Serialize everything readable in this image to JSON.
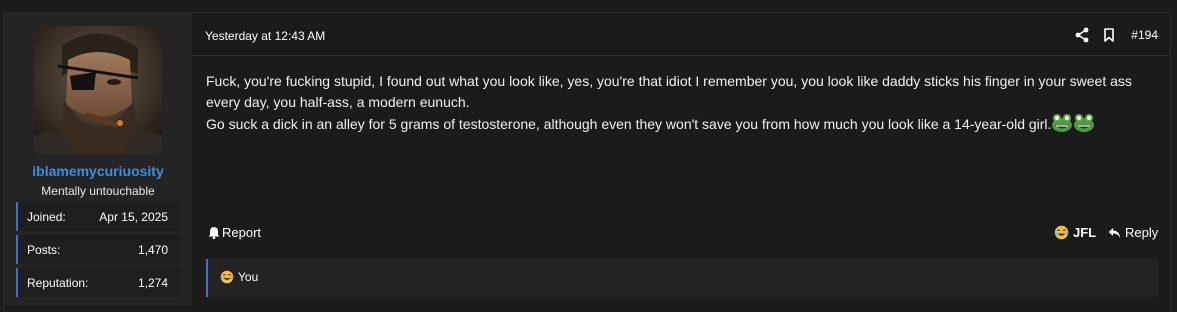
{
  "user": {
    "username": "iblamemycuriuosity",
    "title": "Mentally untouchable",
    "avatar_icon": "bearded-eyepatch-man-avatar",
    "stats": [
      {
        "label": "Joined:",
        "value": "Apr 15, 2025"
      },
      {
        "label": "Posts:",
        "value": "1,470"
      },
      {
        "label": "Reputation:",
        "value": "1,274"
      }
    ]
  },
  "post": {
    "timestamp": "Yesterday at 12:43 AM",
    "post_number": "#194",
    "message_lines": [
      "Fuck, you're fucking stupid, I found out what you look like, yes, you're that idiot I remember you, you look like daddy sticks his finger in your sweet ass every day, you half-ass, a modern eunuch.",
      "Go suck a dick in an alley for 5 grams of testosterone, although even they won't save you from how much you look like a 14-year-old girl."
    ],
    "inline_emojis": [
      "frog-laugh-emoji",
      "frog-laugh-emoji"
    ]
  },
  "actions": {
    "report_label": "Report",
    "report_icon": "bell-icon",
    "reaction_label": "JFL",
    "reaction_icon": "laughing-tears-emoji",
    "reply_label": "Reply",
    "reply_icon": "reply-arrow-icon",
    "share_icon": "share-icon",
    "bookmark_icon": "bookmark-icon"
  },
  "reactions": {
    "summary_text": "You",
    "icon": "laughing-tears-emoji"
  },
  "colors": {
    "background": "#1b1b1b",
    "sidebar": "#242424",
    "username": "#3d8fe0",
    "accent_border": "#4a6bc4"
  }
}
